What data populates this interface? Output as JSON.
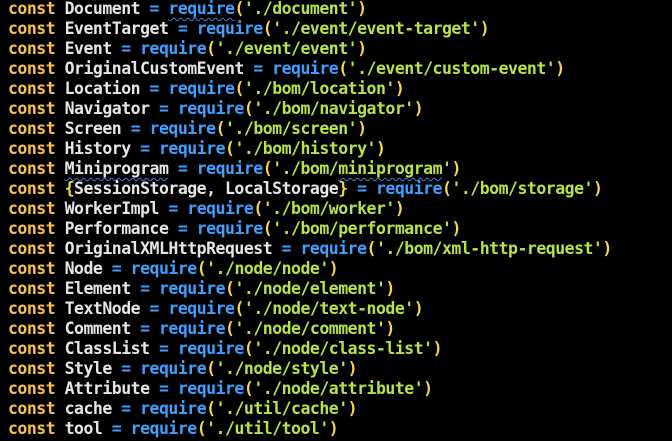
{
  "editor": {
    "lines": [
      {
        "keyword": "const",
        "name": "Document",
        "op": "=",
        "fn": "require",
        "path": "'./document'",
        "fn_squiggle": true,
        "name_squiggle": false
      },
      {
        "keyword": "const",
        "name": "EventTarget",
        "op": "=",
        "fn": "require",
        "path": "'./event/event-target'"
      },
      {
        "keyword": "const",
        "name": "Event",
        "op": "=",
        "fn": "require",
        "path": "'./event/event'"
      },
      {
        "keyword": "const",
        "name": "OriginalCustomEvent",
        "op": "=",
        "fn": "require",
        "path": "'./event/custom-event'"
      },
      {
        "keyword": "const",
        "name": "Location",
        "op": "=",
        "fn": "require",
        "path": "'./bom/location'"
      },
      {
        "keyword": "const",
        "name": "Navigator",
        "op": "=",
        "fn": "require",
        "path": "'./bom/navigator'"
      },
      {
        "keyword": "const",
        "name": "Screen",
        "op": "=",
        "fn": "require",
        "path": "'./bom/screen'"
      },
      {
        "keyword": "const",
        "name": "History",
        "op": "=",
        "fn": "require",
        "path": "'./bom/history'"
      },
      {
        "keyword": "const",
        "name": "Miniprogram",
        "op": "=",
        "fn": "require",
        "path_prefix": "'./bom/",
        "path_squiggle": "miniprogram",
        "path_suffix": "')",
        "name_squiggle": true
      },
      {
        "keyword": "const",
        "destructure_open": "{",
        "name": "SessionStorage, LocalStorage",
        "destructure_close": "}",
        "op": "=",
        "fn": "require",
        "path": "'./bom/storage'"
      },
      {
        "keyword": "const",
        "name": "WorkerImpl",
        "op": "=",
        "fn": "require",
        "path": "'./bom/worker'"
      },
      {
        "keyword": "const",
        "name": "Performance",
        "op": "=",
        "fn": "require",
        "path": "'./bom/performance'"
      },
      {
        "keyword": "const",
        "name": "OriginalXMLHttpRequest",
        "op": "=",
        "fn": "require",
        "path": "'./bom/xml-http-request'"
      },
      {
        "keyword": "const",
        "name": "Node",
        "op": "=",
        "fn": "require",
        "path": "'./node/node'"
      },
      {
        "keyword": "const",
        "name": "Element",
        "op": "=",
        "fn": "require",
        "path": "'./node/element'"
      },
      {
        "keyword": "const",
        "name": "TextNode",
        "op": "=",
        "fn": "require",
        "path": "'./node/text-node'"
      },
      {
        "keyword": "const",
        "name": "Comment",
        "op": "=",
        "fn": "require",
        "path": "'./node/comment'"
      },
      {
        "keyword": "const",
        "name": "ClassList",
        "op": "=",
        "fn": "require",
        "path": "'./node/class-list'"
      },
      {
        "keyword": "const",
        "name": "Style",
        "op": "=",
        "fn": "require",
        "path": "'./node/style'"
      },
      {
        "keyword": "const",
        "name": "Attribute",
        "op": "=",
        "fn": "require",
        "path": "'./node/attribute'"
      },
      {
        "keyword": "const",
        "name": "cache",
        "op": "=",
        "fn": "require",
        "path": "'./util/cache'"
      },
      {
        "keyword": "const",
        "name": "tool",
        "op": "=",
        "fn": "require",
        "path": "'./util/tool'"
      }
    ],
    "punct": {
      "open_paren": "(",
      "close_paren": ")"
    }
  },
  "colors": {
    "background": "#000000",
    "keyword": "#f7c14a",
    "identifier": "#e6e6e6",
    "function": "#3fa0ff",
    "string": "#b6e34a"
  }
}
